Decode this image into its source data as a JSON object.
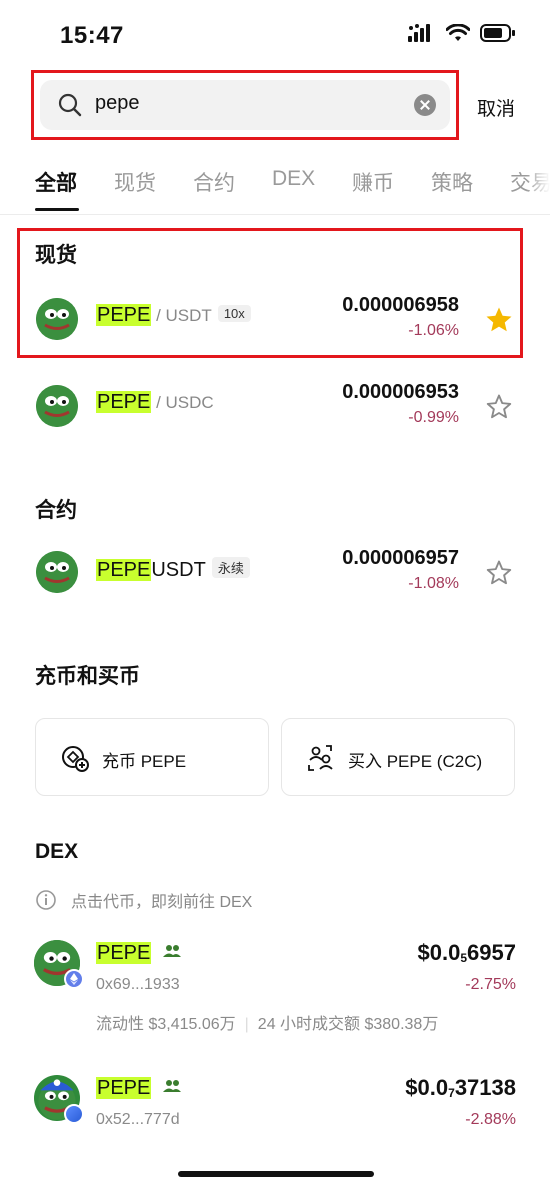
{
  "status_bar": {
    "time": "15:47"
  },
  "search": {
    "value": "pepe",
    "cancel_label": "取消"
  },
  "tabs": [
    {
      "label": "全部",
      "active": true
    },
    {
      "label": "现货",
      "active": false
    },
    {
      "label": "合约",
      "active": false
    },
    {
      "label": "DEX",
      "active": false
    },
    {
      "label": "赚币",
      "active": false
    },
    {
      "label": "策略",
      "active": false
    },
    {
      "label": "交易",
      "active": false
    }
  ],
  "spot": {
    "title": "现货",
    "rows": [
      {
        "symbol": "PEPE",
        "quote": " / USDT",
        "tag": "10x",
        "price": "0.000006958",
        "change": "-1.06%",
        "favorited": true
      },
      {
        "symbol": "PEPE",
        "quote": " / USDC",
        "price": "0.000006953",
        "change": "-0.99%",
        "favorited": false
      }
    ]
  },
  "futures": {
    "title": "合约",
    "rows": [
      {
        "symbol": "PEPE",
        "suffix": "USDT",
        "tag": "永续",
        "price": "0.000006957",
        "change": "-1.08%",
        "favorited": false
      }
    ]
  },
  "deposit_buy": {
    "title": "充币和买币",
    "deposit_label": "充币 PEPE",
    "buy_label": "买入 PEPE (C2C)"
  },
  "dex": {
    "title": "DEX",
    "info": "点击代币，即刻前往 DEX",
    "rows": [
      {
        "symbol": "PEPE",
        "address": "0x69...1933",
        "price_prefix": "$0.0",
        "price_sub": "5",
        "price_rest": "6957",
        "change": "-2.75%",
        "liquidity": "流动性 $3,415.06万",
        "volume": "24 小时成交额 $380.38万"
      },
      {
        "symbol": "PEPE",
        "address": "0x52...777d",
        "price_prefix": "$0.0",
        "price_sub": "7",
        "price_rest": "37138",
        "change": "-2.88%"
      }
    ]
  },
  "colors": {
    "highlight": "#c8ff2e",
    "negative": "#a33a5a",
    "star_active": "#f5b800",
    "annotation_red": "#e3171c"
  }
}
